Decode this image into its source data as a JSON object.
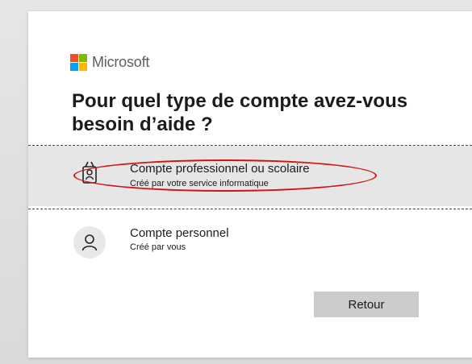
{
  "brand": {
    "logo_icon": "microsoft-logo-icon",
    "name": "Microsoft",
    "logo_colors": [
      "#f25022",
      "#7fba00",
      "#00a4ef",
      "#ffb900"
    ]
  },
  "title": "Pour quel type de compte avez-vous besoin d’aide ?",
  "options": [
    {
      "icon": "id-badge-icon",
      "label": "Compte professionnel ou scolaire",
      "description": "Créé par votre service informatique",
      "selected": true
    },
    {
      "icon": "person-icon",
      "label": "Compte personnel",
      "description": "Créé par vous",
      "selected": false
    }
  ],
  "back_button": {
    "label": "Retour"
  },
  "colors": {
    "highlight_ellipse": "#d01212",
    "selected_background": "#e6e6e6",
    "button_background": "#cccccc"
  }
}
